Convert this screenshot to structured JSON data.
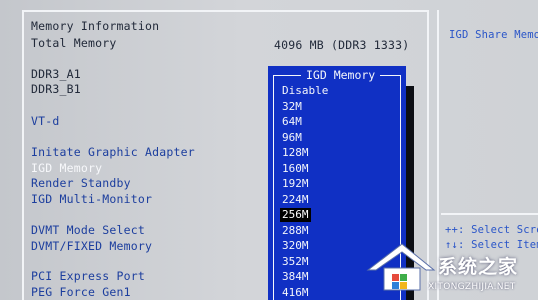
{
  "left": {
    "section_title": "Memory Information",
    "total_memory_label": "Total Memory",
    "total_memory_value": "4096 MB (DDR3 1333)",
    "ddr3_a1": "DDR3_A1",
    "ddr3_b1": "DDR3_B1",
    "vtd": "VT-d",
    "initiate_graphic_adapter": "Initate Graphic Adapter",
    "igd_memory": "IGD Memory",
    "render_standby": "Render Standby",
    "igd_multi_monitor": "IGD Multi-Monitor",
    "dvmt_mode_select": "DVMT Mode Select",
    "dvmt_fixed_memory": "DVMT/FIXED Memory",
    "pci_express_port": "PCI Express Port",
    "peg_force_gen1": "PEG Force Gen1"
  },
  "popup": {
    "title": "IGD Memory",
    "selected": "256M",
    "options": [
      "Disable",
      "32M",
      "64M",
      "96M",
      "128M",
      "160M",
      "192M",
      "224M",
      "256M",
      "288M",
      "320M",
      "352M",
      "384M",
      "416M"
    ]
  },
  "help": {
    "title": "IGD Share Memor",
    "select_screen": "++: Select Scre",
    "select_item": "↑↓: Select Item"
  },
  "watermark": {
    "text": "系统之家",
    "url": "XITONGZHIJIA.NET"
  },
  "colors": {
    "background": "#cfd2d6",
    "label_blue": "#1c3e9e",
    "popup_blue": "#1030c4",
    "help_blue": "#2a55c8"
  }
}
